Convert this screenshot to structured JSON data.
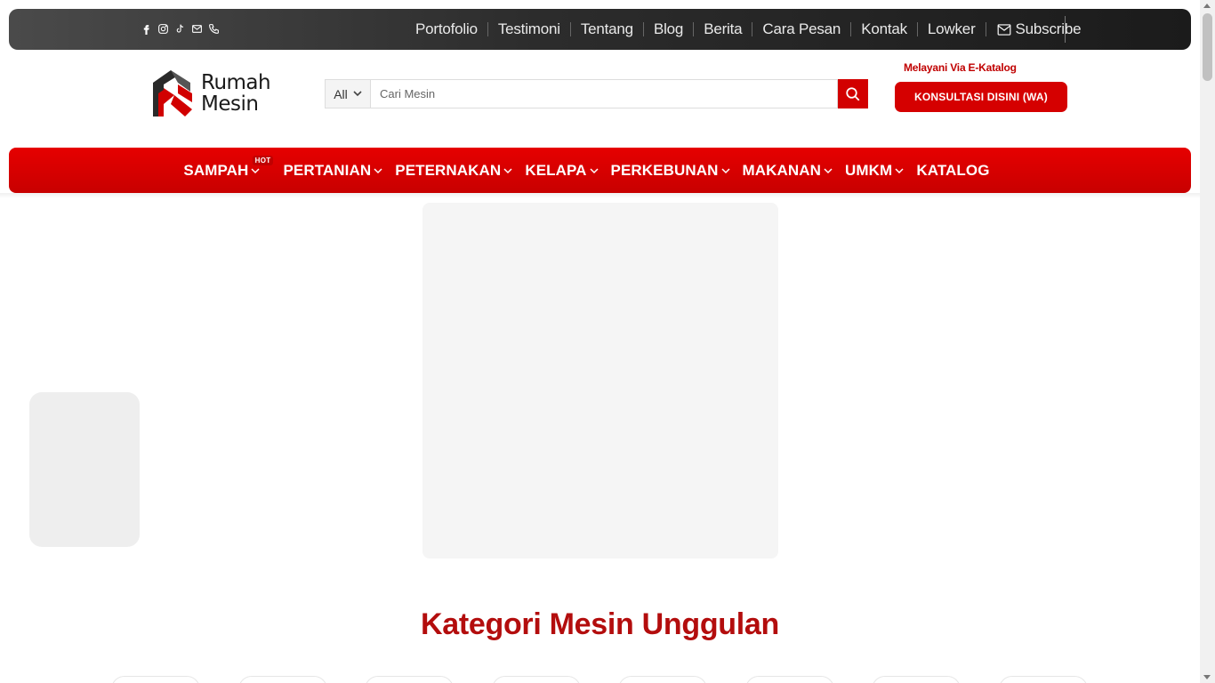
{
  "topbar": {
    "social_icons": [
      "facebook-icon",
      "instagram-icon",
      "tiktok-icon",
      "envelope-icon",
      "phone-icon"
    ],
    "links": [
      "Portofolio",
      "Testimoni",
      "Tentang",
      "Blog",
      "Berita",
      "Cara Pesan",
      "Kontak",
      "Lowker"
    ],
    "subscribe_label": "Subscribe"
  },
  "header": {
    "logo_line1": "Rumah",
    "logo_line2": "Mesin",
    "search": {
      "category": "All",
      "placeholder": "Cari Mesin"
    },
    "ekatalog_text": "Melayani Via E-Katalog",
    "consult_button": "KONSULTASI DISINI (WA)"
  },
  "main_nav": {
    "items": [
      {
        "label": "SAMPAH",
        "badge": "HOT"
      },
      {
        "label": "PERTANIAN"
      },
      {
        "label": "PETERNAKAN"
      },
      {
        "label": "KELAPA"
      },
      {
        "label": "PERKEBUNAN"
      },
      {
        "label": "MAKANAN"
      },
      {
        "label": "UMKM"
      },
      {
        "label": "KATALOG"
      }
    ]
  },
  "content": {
    "section_title": "Kategori Mesin Unggulan"
  },
  "colors": {
    "brand_red": "#d20000",
    "title_red": "#b30d0d",
    "topbar_dark": "#2c2c2c"
  }
}
